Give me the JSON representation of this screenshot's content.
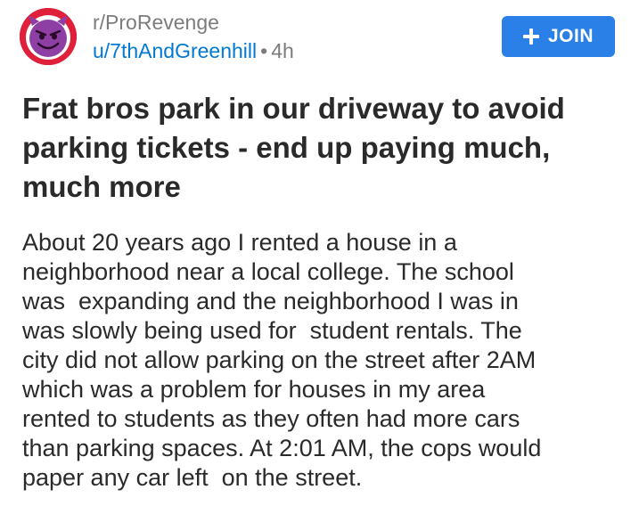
{
  "header": {
    "subreddit": "r/ProRevenge",
    "username": "u/7thAndGreenhill",
    "separator": "•",
    "age": "4h",
    "avatar_icon": "devil-face-icon",
    "join_icon": "plus-icon",
    "join_label": "JOIN"
  },
  "post": {
    "title": "Frat bros park in our driveway to avoid parking tickets - end up paying much, much more",
    "body_lines": [
      "About 20 years ago I rented a house in a",
      "neighborhood near a local college. The school",
      "was  expanding and the neighborhood I was in",
      "was slowly being used for  student rentals. The",
      "city did not allow parking on the street after 2AM",
      "which was a problem for houses in my area",
      "rented to students as they often had more cars",
      "than parking spaces. At 2:01 AM, the cops would",
      "paper any car left  on the street."
    ]
  },
  "colors": {
    "link_blue": "#0079d3",
    "join_button": "#2a80e6",
    "meta_gray": "#7c7c7c",
    "avatar_red": "#e0203a",
    "avatar_purple": "#8e3fa4"
  }
}
